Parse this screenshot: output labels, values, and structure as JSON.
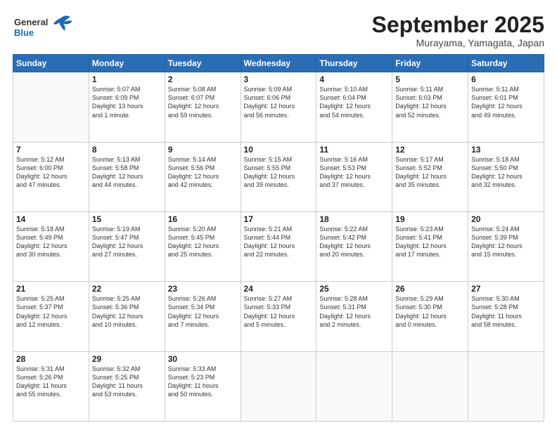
{
  "logo": {
    "general": "General",
    "blue": "Blue"
  },
  "header": {
    "month": "September 2025",
    "location": "Murayama, Yamagata, Japan"
  },
  "weekdays": [
    "Sunday",
    "Monday",
    "Tuesday",
    "Wednesday",
    "Thursday",
    "Friday",
    "Saturday"
  ],
  "weeks": [
    [
      {
        "day": "",
        "info": ""
      },
      {
        "day": "1",
        "info": "Sunrise: 5:07 AM\nSunset: 6:09 PM\nDaylight: 13 hours\nand 1 minute."
      },
      {
        "day": "2",
        "info": "Sunrise: 5:08 AM\nSunset: 6:07 PM\nDaylight: 12 hours\nand 59 minutes."
      },
      {
        "day": "3",
        "info": "Sunrise: 5:09 AM\nSunset: 6:06 PM\nDaylight: 12 hours\nand 56 minutes."
      },
      {
        "day": "4",
        "info": "Sunrise: 5:10 AM\nSunset: 6:04 PM\nDaylight: 12 hours\nand 54 minutes."
      },
      {
        "day": "5",
        "info": "Sunrise: 5:11 AM\nSunset: 6:03 PM\nDaylight: 12 hours\nand 52 minutes."
      },
      {
        "day": "6",
        "info": "Sunrise: 5:11 AM\nSunset: 6:01 PM\nDaylight: 12 hours\nand 49 minutes."
      }
    ],
    [
      {
        "day": "7",
        "info": "Sunrise: 5:12 AM\nSunset: 6:00 PM\nDaylight: 12 hours\nand 47 minutes."
      },
      {
        "day": "8",
        "info": "Sunrise: 5:13 AM\nSunset: 5:58 PM\nDaylight: 12 hours\nand 44 minutes."
      },
      {
        "day": "9",
        "info": "Sunrise: 5:14 AM\nSunset: 5:56 PM\nDaylight: 12 hours\nand 42 minutes."
      },
      {
        "day": "10",
        "info": "Sunrise: 5:15 AM\nSunset: 5:55 PM\nDaylight: 12 hours\nand 39 minutes."
      },
      {
        "day": "11",
        "info": "Sunrise: 5:16 AM\nSunset: 5:53 PM\nDaylight: 12 hours\nand 37 minutes."
      },
      {
        "day": "12",
        "info": "Sunrise: 5:17 AM\nSunset: 5:52 PM\nDaylight: 12 hours\nand 35 minutes."
      },
      {
        "day": "13",
        "info": "Sunrise: 5:18 AM\nSunset: 5:50 PM\nDaylight: 12 hours\nand 32 minutes."
      }
    ],
    [
      {
        "day": "14",
        "info": "Sunrise: 5:18 AM\nSunset: 5:49 PM\nDaylight: 12 hours\nand 30 minutes."
      },
      {
        "day": "15",
        "info": "Sunrise: 5:19 AM\nSunset: 5:47 PM\nDaylight: 12 hours\nand 27 minutes."
      },
      {
        "day": "16",
        "info": "Sunrise: 5:20 AM\nSunset: 5:45 PM\nDaylight: 12 hours\nand 25 minutes."
      },
      {
        "day": "17",
        "info": "Sunrise: 5:21 AM\nSunset: 5:44 PM\nDaylight: 12 hours\nand 22 minutes."
      },
      {
        "day": "18",
        "info": "Sunrise: 5:22 AM\nSunset: 5:42 PM\nDaylight: 12 hours\nand 20 minutes."
      },
      {
        "day": "19",
        "info": "Sunrise: 5:23 AM\nSunset: 5:41 PM\nDaylight: 12 hours\nand 17 minutes."
      },
      {
        "day": "20",
        "info": "Sunrise: 5:24 AM\nSunset: 5:39 PM\nDaylight: 12 hours\nand 15 minutes."
      }
    ],
    [
      {
        "day": "21",
        "info": "Sunrise: 5:25 AM\nSunset: 5:37 PM\nDaylight: 12 hours\nand 12 minutes."
      },
      {
        "day": "22",
        "info": "Sunrise: 5:25 AM\nSunset: 5:36 PM\nDaylight: 12 hours\nand 10 minutes."
      },
      {
        "day": "23",
        "info": "Sunrise: 5:26 AM\nSunset: 5:34 PM\nDaylight: 12 hours\nand 7 minutes."
      },
      {
        "day": "24",
        "info": "Sunrise: 5:27 AM\nSunset: 5:33 PM\nDaylight: 12 hours\nand 5 minutes."
      },
      {
        "day": "25",
        "info": "Sunrise: 5:28 AM\nSunset: 5:31 PM\nDaylight: 12 hours\nand 2 minutes."
      },
      {
        "day": "26",
        "info": "Sunrise: 5:29 AM\nSunset: 5:30 PM\nDaylight: 12 hours\nand 0 minutes."
      },
      {
        "day": "27",
        "info": "Sunrise: 5:30 AM\nSunset: 5:28 PM\nDaylight: 11 hours\nand 58 minutes."
      }
    ],
    [
      {
        "day": "28",
        "info": "Sunrise: 5:31 AM\nSunset: 5:26 PM\nDaylight: 11 hours\nand 55 minutes."
      },
      {
        "day": "29",
        "info": "Sunrise: 5:32 AM\nSunset: 5:25 PM\nDaylight: 11 hours\nand 53 minutes."
      },
      {
        "day": "30",
        "info": "Sunrise: 5:33 AM\nSunset: 5:23 PM\nDaylight: 11 hours\nand 50 minutes."
      },
      {
        "day": "",
        "info": ""
      },
      {
        "day": "",
        "info": ""
      },
      {
        "day": "",
        "info": ""
      },
      {
        "day": "",
        "info": ""
      }
    ]
  ]
}
